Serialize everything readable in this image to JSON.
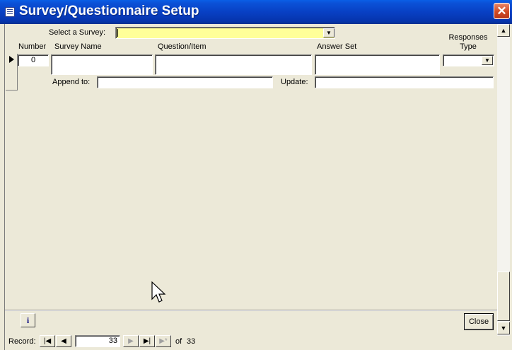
{
  "window": {
    "title": "Survey/Questionnaire Setup",
    "close_glyph": "✕"
  },
  "filter": {
    "label": "Select a Survey:",
    "value": ""
  },
  "columns": {
    "number": "Number",
    "survey_name": "Survey Name",
    "question_item": "Question/Item",
    "answer_set": "Answer Set",
    "responses_type": "Responses Type"
  },
  "record": {
    "number": "0",
    "survey_name": "",
    "question_item": "",
    "answer_set": "",
    "responses_type": "",
    "append_to_label": "Append to:",
    "append_to_value": "",
    "update_label": "Update:",
    "update_value": ""
  },
  "footer": {
    "info_label": "i",
    "close_label": "Close"
  },
  "nav": {
    "label": "Record:",
    "current": "33",
    "of_label": "of",
    "total": "33"
  }
}
